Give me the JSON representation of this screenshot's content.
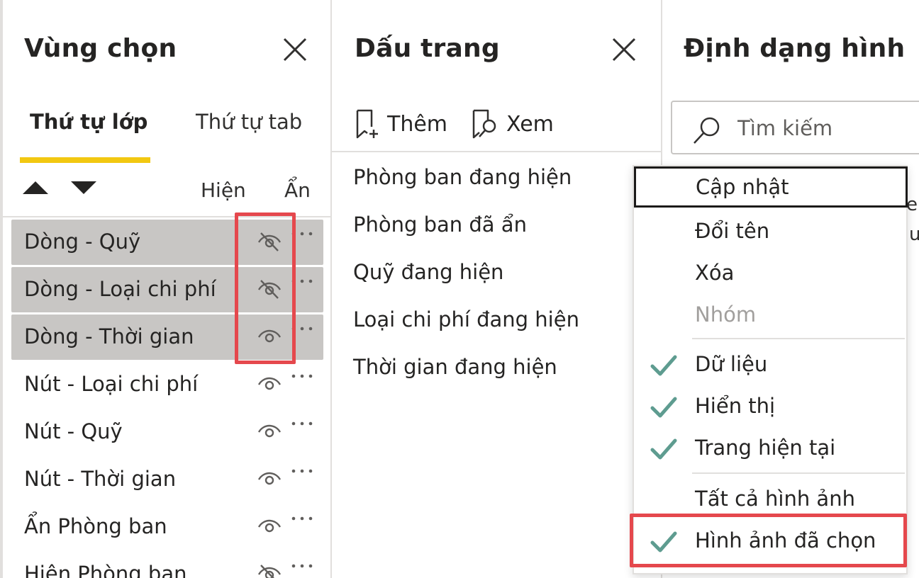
{
  "colors": {
    "accent": "#f2c811",
    "highlight": "#e5484d",
    "check": "#5e9c90",
    "selected_row": "#c8c6c4"
  },
  "selection_pane": {
    "title": "Vùng chọn",
    "tabs": [
      "Thứ tự lớp",
      "Thứ tự tab"
    ],
    "active_tab": "Thứ tự lớp",
    "col_show": "Hiện",
    "col_hide": "Ẩn",
    "layers": [
      {
        "label": "Dòng - Quỹ",
        "visibility": "hidden",
        "selected": true
      },
      {
        "label": "Dòng - Loại chi phí",
        "visibility": "hidden",
        "selected": true
      },
      {
        "label": "Dòng - Thời gian",
        "visibility": "visible",
        "selected": true
      },
      {
        "label": "Nút - Loại chi phí",
        "visibility": "visible",
        "selected": false
      },
      {
        "label": "Nút - Quỹ",
        "visibility": "visible",
        "selected": false
      },
      {
        "label": "Nút - Thời gian",
        "visibility": "visible",
        "selected": false
      },
      {
        "label": "Ẩn Phòng ban",
        "visibility": "visible",
        "selected": false
      },
      {
        "label": "Hiện Phòng ban",
        "visibility": "hidden",
        "selected": false
      }
    ]
  },
  "bookmarks_pane": {
    "title": "Dấu trang",
    "add_label": "Thêm",
    "view_label": "Xem",
    "items": [
      "Phòng ban đang hiện",
      "Phòng ban đã ẩn",
      "Quỹ đang hiện",
      "Loại chi phí đang hiện",
      "Thời gian đang hiện"
    ]
  },
  "format_pane": {
    "title": "Định dạng hình",
    "search_placeholder": "Tìm kiếm",
    "peek_text_1": "e",
    "peek_text_2": "u"
  },
  "context_menu": {
    "items": [
      {
        "label": "Cập nhật",
        "checked": false,
        "disabled": false,
        "focused": true
      },
      {
        "label": "Đổi tên",
        "checked": false,
        "disabled": false,
        "focused": false
      },
      {
        "label": "Xóa",
        "checked": false,
        "disabled": false,
        "focused": false
      },
      {
        "label": "Nhóm",
        "checked": false,
        "disabled": true,
        "focused": false
      },
      {
        "label": "Dữ liệu",
        "checked": true,
        "disabled": false,
        "focused": false
      },
      {
        "label": "Hiển thị",
        "checked": true,
        "disabled": false,
        "focused": false
      },
      {
        "label": "Trang hiện tại",
        "checked": true,
        "disabled": false,
        "focused": false
      },
      {
        "label": "Tất cả hình ảnh",
        "checked": false,
        "disabled": false,
        "focused": false
      },
      {
        "label": "Hình ảnh đã chọn",
        "checked": true,
        "disabled": false,
        "focused": false
      }
    ]
  }
}
